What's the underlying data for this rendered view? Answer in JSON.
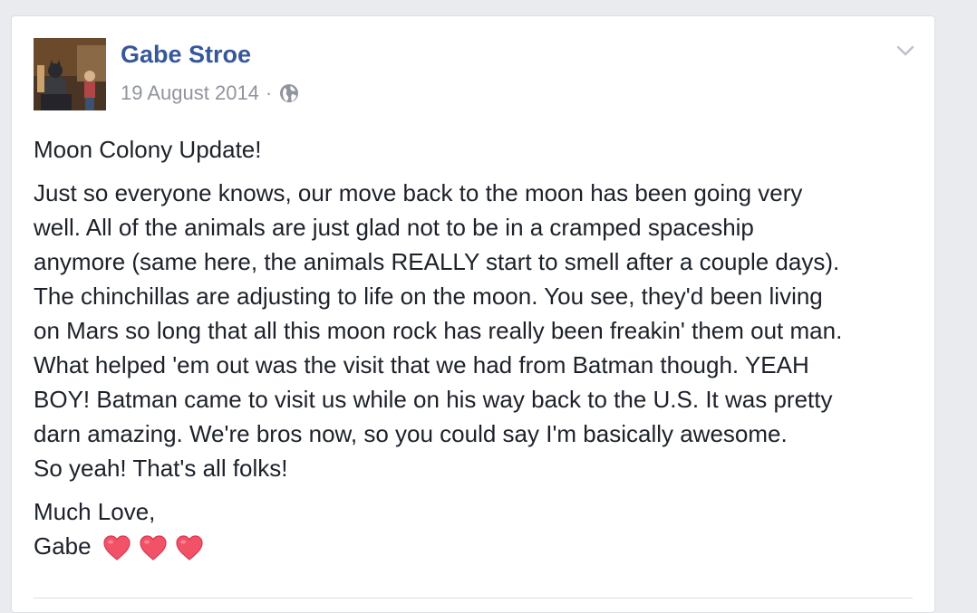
{
  "post": {
    "author": "Gabe Stroe",
    "date": "19 August 2014",
    "separator": "·",
    "privacy_icon": "globe-icon",
    "menu_icon": "chevron-down-icon",
    "title_line": "Moon Colony Update!",
    "body_lines": [
      "Just so everyone knows, our move back to the moon has been going very",
      "well. All of the animals are just glad not to be in a cramped spaceship",
      "anymore (same here, the animals REALLY start to smell after a couple days).",
      "The chinchillas are adjusting to life on the moon. You see, they'd been living",
      "on Mars so long that all this moon rock has really been freakin' them out man.",
      "What helped 'em out was the visit that we had from Batman though. YEAH",
      "BOY! Batman came to visit us while on his way back to the U.S. It was pretty",
      "darn amazing. We're bros now, so you could say I'm basically awesome.",
      "So yeah! That's all folks!"
    ],
    "sign_off": "Much Love,",
    "signature": "Gabe",
    "heart_icon": "heart-emoji-icon"
  },
  "colors": {
    "author_link": "#365899",
    "meta_gray": "#90949c",
    "body_text": "#1d2129",
    "heart": "#f25268"
  }
}
